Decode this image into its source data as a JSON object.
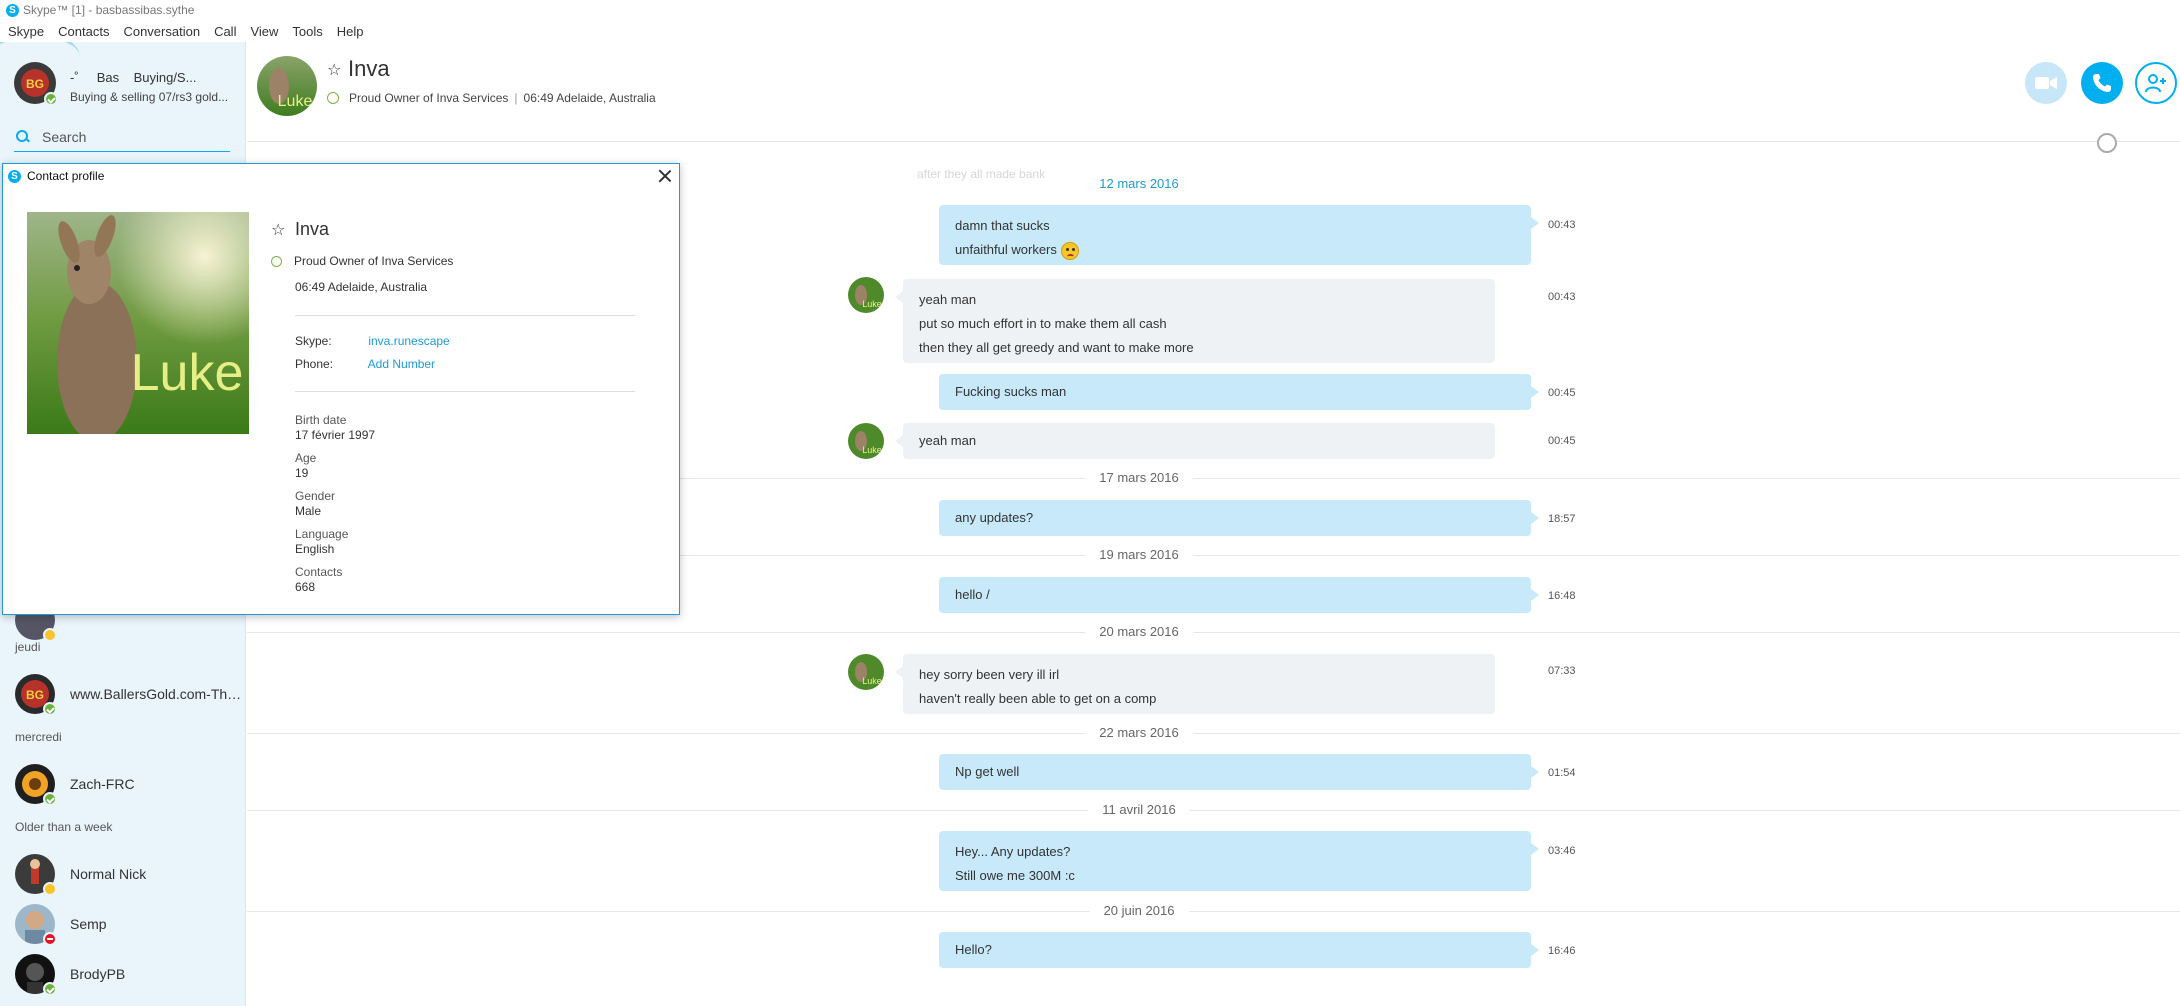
{
  "window": {
    "title": "Skype™ [1] - basbassibas.sythe"
  },
  "menu": [
    "Skype",
    "Contacts",
    "Conversation",
    "Call",
    "View",
    "Tools",
    "Help"
  ],
  "me": {
    "name": "-˚     Bas    Buying/S...",
    "mood": "Buying & selling 07/rs3 gold..."
  },
  "search": {
    "placeholder": "Search"
  },
  "sidebar": {
    "groups": [
      {
        "label": "jeudi",
        "contacts": [
          {
            "name": "www.BallersGold.com-The...",
            "status": "online"
          }
        ]
      },
      {
        "label": "mercredi",
        "contacts": [
          {
            "name": "Zach-FRC",
            "status": "online"
          }
        ]
      },
      {
        "label": "Older than a week",
        "contacts": [
          {
            "name": "Normal Nick",
            "status": "away"
          },
          {
            "name": "Semp",
            "status": "busy"
          },
          {
            "name": "BrodyPB",
            "status": "online"
          }
        ]
      }
    ]
  },
  "header": {
    "name": "Inva",
    "mood": "Proud Owner of Inva Services",
    "local_time": "06:49 Adelaide, Australia",
    "separator": "|"
  },
  "conversation": {
    "faded_text": "after they all made bank",
    "items": [
      {
        "type": "date",
        "label": "12 mars 2016"
      },
      {
        "type": "msg",
        "dir": "out",
        "lines": [
          "damn that sucks",
          "unfaithful workers"
        ],
        "time": "00:43",
        "emoji": "sad-face"
      },
      {
        "type": "msg",
        "dir": "in",
        "lines": [
          "yeah man",
          "put so much effort in to make them all cash",
          "then they all get greedy and want to make more"
        ],
        "time": "00:43"
      },
      {
        "type": "msg",
        "dir": "out",
        "lines": [
          "Fucking sucks man"
        ],
        "time": "00:45"
      },
      {
        "type": "msg",
        "dir": "in",
        "lines": [
          "yeah man"
        ],
        "time": "00:45"
      },
      {
        "type": "date",
        "label": "17 mars 2016"
      },
      {
        "type": "msg",
        "dir": "out",
        "lines": [
          "any updates?"
        ],
        "time": "18:57"
      },
      {
        "type": "date",
        "label": "19 mars 2016"
      },
      {
        "type": "msg",
        "dir": "out",
        "lines": [
          "hello /"
        ],
        "time": "16:48"
      },
      {
        "type": "date",
        "label": "20 mars 2016"
      },
      {
        "type": "msg",
        "dir": "in",
        "lines": [
          "hey sorry been very ill irl",
          "haven't really been able to get on a comp"
        ],
        "time": "07:33"
      },
      {
        "type": "date",
        "label": "22 mars 2016"
      },
      {
        "type": "msg",
        "dir": "out",
        "lines": [
          "Np get well"
        ],
        "time": "01:54"
      },
      {
        "type": "date",
        "label": "11 avril 2016"
      },
      {
        "type": "msg",
        "dir": "out",
        "lines": [
          "Hey... Any updates?",
          "Still owe me 300M :c"
        ],
        "time": "03:46"
      },
      {
        "type": "date",
        "label": "20 juin 2016"
      },
      {
        "type": "msg",
        "dir": "out",
        "lines": [
          "Hello?"
        ],
        "time": "16:46"
      }
    ]
  },
  "profile": {
    "title": "Contact profile",
    "name": "Inva",
    "mood": "Proud Owner of Inva Services",
    "local_time": "06:49 Adelaide, Australia",
    "photo_text": "Luke",
    "skype_label": "Skype:",
    "skype_value": "inva.runescape",
    "phone_label": "Phone:",
    "phone_value": "Add Number",
    "fields": [
      {
        "label": "Birth date",
        "value": "17 février 1997"
      },
      {
        "label": "Age",
        "value": "19"
      },
      {
        "label": "Gender",
        "value": "Male"
      },
      {
        "label": "Language",
        "value": "English"
      },
      {
        "label": "Contacts",
        "value": "668"
      }
    ]
  },
  "colors": {
    "accent": "#00aff0",
    "outgoing": "#c7e9fa",
    "incoming": "#eef2f5",
    "online": "#6cb33e",
    "away": "#f8c42a",
    "busy": "#e81123"
  }
}
